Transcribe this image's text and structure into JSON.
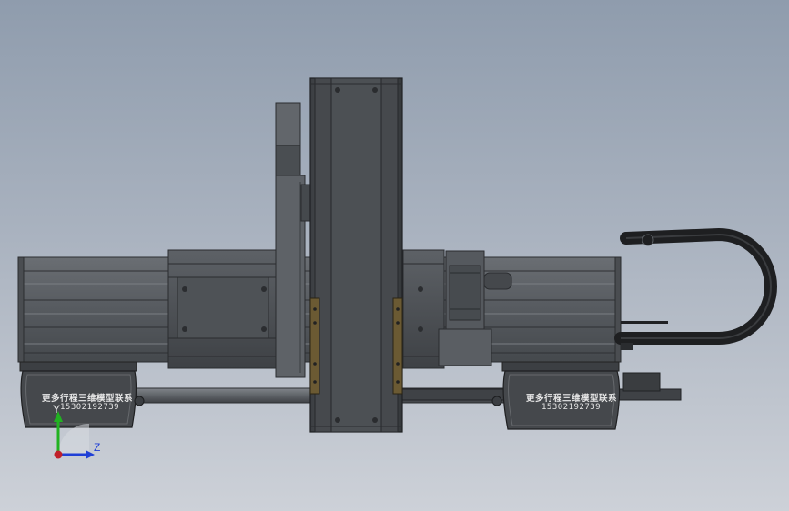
{
  "model": {
    "left_block_text": "更多行程三维模型联系",
    "left_block_phone": "15302192739",
    "right_block_text": "更多行程三维模型联系",
    "right_block_phone": "15302192739"
  },
  "triad": {
    "y_label": "Y",
    "z_label": "Z",
    "y_color": "#21b221",
    "z_color": "#1f3fd6",
    "origin_color": "#c0202a"
  },
  "colors": {
    "background_top": "#8f9cad",
    "background_bottom": "#cdd1d8",
    "metal_dark": "#3a3d40",
    "metal_mid": "#5a5e63",
    "metal_light": "#7c8085",
    "slider_brown": "#6b5a33"
  }
}
